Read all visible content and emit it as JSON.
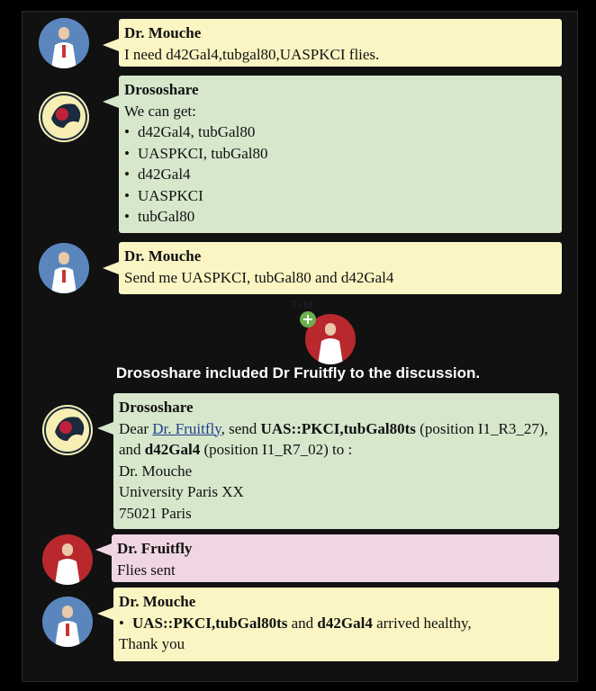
{
  "colors": {
    "bubble_user": "#fbf5c3",
    "bubble_bot": "#d6e7cc",
    "bubble_fruitfly": "#f0d6e2",
    "background": "#000000",
    "avatar_blue": "#4b7bb3",
    "avatar_red": "#b8282c"
  },
  "messages": [
    {
      "sender": "Dr. Mouche",
      "lines": [
        "I need d42Gal4,tubgal80,UASPKCI flies."
      ]
    },
    {
      "sender": "Drososhare",
      "intro": "We can get:",
      "items": [
        "d42Gal4, tubGal80",
        "UASPKCI, tubGal80",
        "d42Gal4",
        "UASPKCI",
        "tubGal80"
      ]
    },
    {
      "sender": "Dr. Mouche",
      "lines": [
        "Send me UASPKCI, tubGal80 and d42Gal4"
      ]
    },
    {
      "sender": "Drososhare",
      "p1": "Dear ",
      "link": "Dr. Fruitfly",
      "p2": ", send ",
      "b1": "UAS::PKCI,tubGal80ts",
      "p3": " (position I1_R3_27), and ",
      "b2": "d42Gal4",
      "p4": " (position I1_R7_02) to :",
      "address": [
        "Dr. Mouche",
        "University Paris XX",
        "75021 Paris"
      ]
    },
    {
      "sender": "Dr. Fruitfly",
      "lines": [
        "Flies sent"
      ]
    },
    {
      "sender": "Dr. Mouche",
      "bullet_b1": "UAS::PKCI,tubGal80ts",
      "bullet_p1": " and ",
      "bullet_b2": "d42Gal4",
      "bullet_p2": " arrived healthy,",
      "closing": "Thank you"
    }
  ],
  "notice": "Drososhare included Dr Fruitfly to the discussion.",
  "invite_icon_label": "+",
  "tm_label": "T+M"
}
